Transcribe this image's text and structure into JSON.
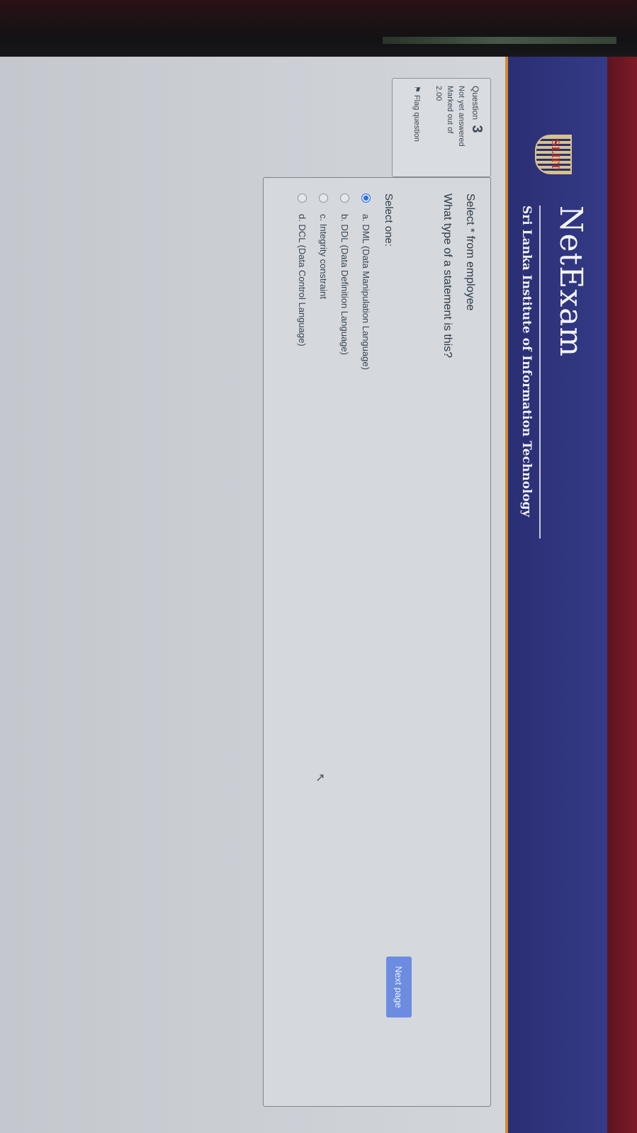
{
  "header": {
    "app_title": "NetExam",
    "institute": "Sri Lanka Institute of Information Technology",
    "logo_text": "SLIIT"
  },
  "question_info": {
    "label": "Question",
    "number": "3",
    "status": "Not yet answered",
    "marked_label": "Marked out of",
    "marks": "2.00",
    "flag_label": "Flag question"
  },
  "question": {
    "line1": "Select * from employee",
    "line2": "What type of a statement is this?",
    "select_one": "Select one:",
    "options": [
      {
        "label": "a. DML (Data Manipulation Language)",
        "checked": true
      },
      {
        "label": "b. DDL (Data Definition Language)",
        "checked": false
      },
      {
        "label": "c. Integrity constraint",
        "checked": false
      },
      {
        "label": "d. DCL (Data Control Language)",
        "checked": false
      }
    ]
  },
  "nav": {
    "next_label": "Next page"
  },
  "colors": {
    "header_bg": "#343a86",
    "brand_bar": "#7d1a27",
    "accent_orange": "#d68a2c",
    "radio_checked": "#2f6fe0",
    "next_button": "#6b8ce0"
  }
}
